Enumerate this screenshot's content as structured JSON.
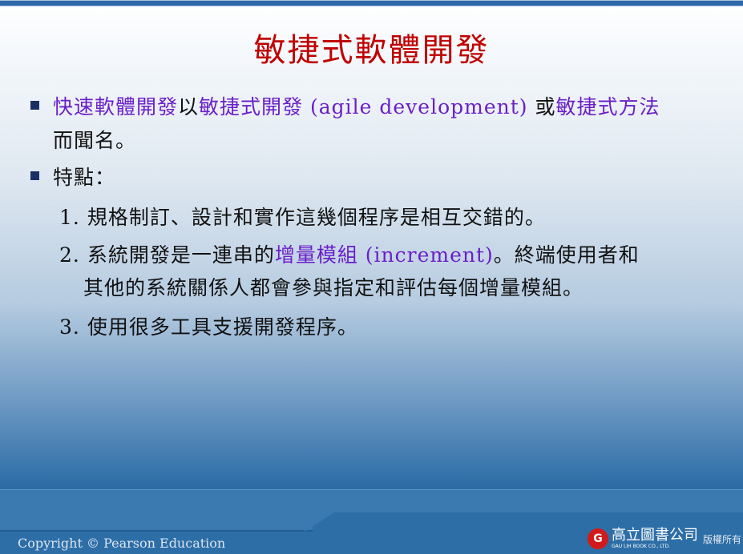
{
  "title": "敏捷式軟體開發",
  "bullets": {
    "b1": {
      "p1": "快速軟體開發",
      "p2": "以",
      "p3": "敏捷式開發",
      "p4": " (agile development) ",
      "p5": "或",
      "p6": "敏捷式方法",
      "cont": "而聞名。"
    },
    "b2": {
      "text": "特點："
    }
  },
  "items": [
    {
      "num": "1.",
      "text": "規格制訂、設計和實作這幾個程序是相互交錯的。"
    },
    {
      "num": "2.",
      "p1": "系統開發是一連串的",
      "p2": "增量模組 (increment)",
      "p3": "。終端使用者和",
      "cont": "其他的系統關係人都會參與指定和評估每個增量模組。"
    },
    {
      "num": "3.",
      "text": "使用很多工具支援開發程序。"
    }
  ],
  "footer": {
    "copyright": "Copyright  © Pearson Education",
    "logo_cn": "高立圖書公司",
    "logo_en": "GAU LIH BOOK CO., LTD.",
    "rights": "版權所有"
  },
  "colors": {
    "title": "#c00000",
    "highlight": "#6a1fc8"
  }
}
